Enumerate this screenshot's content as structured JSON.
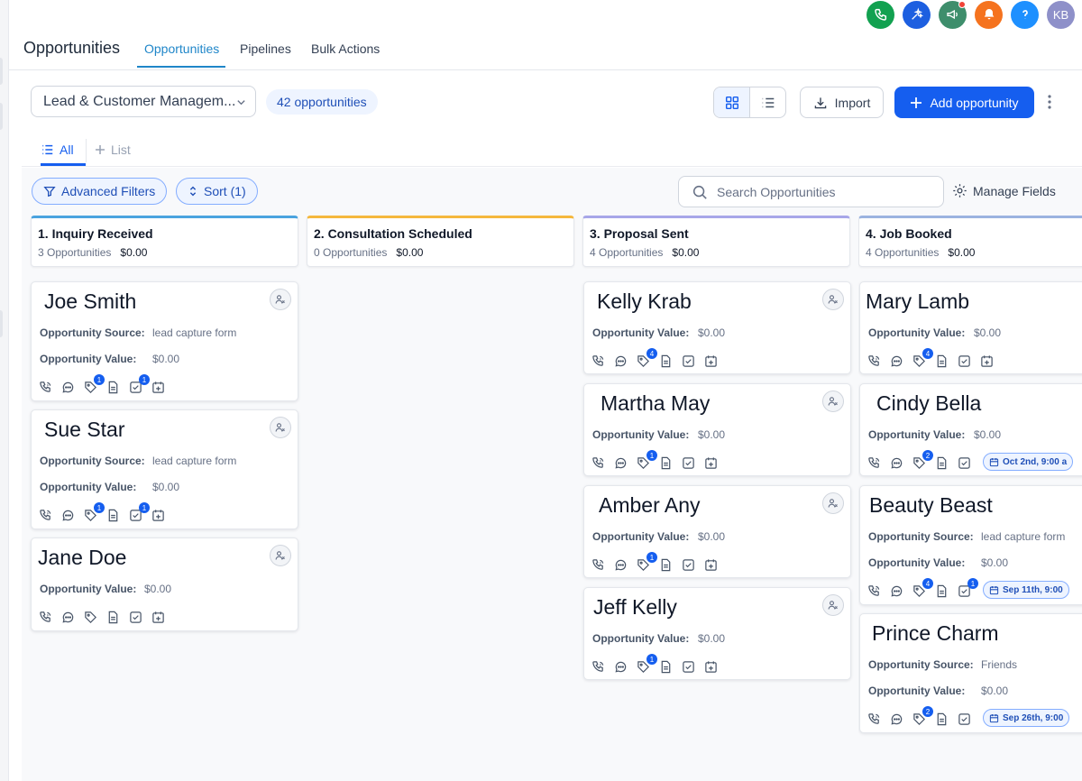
{
  "header": {
    "title": "Opportunities",
    "tabs": [
      {
        "label": "Opportunities"
      },
      {
        "label": "Pipelines"
      },
      {
        "label": "Bulk Actions"
      }
    ]
  },
  "top_bar": {
    "icons": [
      "phone-icon",
      "sparkle-icon",
      "megaphone-icon",
      "bell-icon",
      "help-icon"
    ],
    "avatar_initials": "KB"
  },
  "toolbar": {
    "pipeline": "Lead & Customer Managem...",
    "count": "42 opportunities",
    "import_label": "Import",
    "add_label": "Add opportunity"
  },
  "subtabs": {
    "all": "All",
    "list": "List"
  },
  "filters": {
    "advanced": "Advanced Filters",
    "sort": "Sort (1)",
    "search_placeholder": "Search Opportunities",
    "manage_fields": "Manage Fields"
  },
  "labels": {
    "source": "Opportunity Source:",
    "value": "Opportunity Value:"
  },
  "colors": {
    "primary": "#155eef",
    "stage1": "#4aa3df",
    "stage2": "#f5b83d",
    "stage3": "#a7a6e8",
    "stage4": "#9bb3e0"
  },
  "columns": [
    {
      "title": "1. Inquiry Received",
      "count": "3 Opportunities",
      "amount": "$0.00",
      "cards": [
        {
          "name": "Joe Smith",
          "source": "lead capture form",
          "value": "$0.00",
          "badges": {
            "tag": "1",
            "task": "1"
          }
        },
        {
          "name": "Sue Star",
          "source": "lead capture form",
          "value": "$0.00",
          "badges": {
            "tag": "1",
            "task": "1"
          }
        },
        {
          "name": "Jane Doe",
          "value": "$0.00",
          "badges": {}
        }
      ]
    },
    {
      "title": "2. Consultation Scheduled",
      "count": "0 Opportunities",
      "amount": "$0.00",
      "cards": []
    },
    {
      "title": "3. Proposal Sent",
      "count": "4 Opportunities",
      "amount": "$0.00",
      "cards": [
        {
          "name": "Kelly Krab",
          "value": "$0.00",
          "badges": {
            "tag": "4"
          }
        },
        {
          "name": "Martha May",
          "value": "$0.00",
          "badges": {
            "tag": "1"
          }
        },
        {
          "name": "Amber Any",
          "value": "$0.00",
          "badges": {
            "tag": "1"
          }
        },
        {
          "name": "Jeff Kelly",
          "value": "$0.00",
          "badges": {
            "tag": "1"
          }
        }
      ]
    },
    {
      "title": "4. Job Booked",
      "count": "4 Opportunities",
      "amount": "$0.00",
      "cards": [
        {
          "name": "Mary Lamb",
          "value": "$0.00",
          "badges": {
            "tag": "4"
          }
        },
        {
          "name": "Cindy Bella",
          "value": "$0.00",
          "badges": {
            "tag": "2"
          },
          "appointment": "Oct 2nd, 9:00 a"
        },
        {
          "name": "Beauty Beast",
          "source": "lead capture form",
          "value": "$0.00",
          "badges": {
            "tag": "4",
            "task": "1"
          },
          "appointment": "Sep 11th, 9:00"
        },
        {
          "name": "Prince Charm",
          "source": "Friends",
          "value": "$0.00",
          "badges": {
            "tag": "2"
          },
          "appointment": "Sep 26th, 9:00"
        }
      ]
    }
  ]
}
